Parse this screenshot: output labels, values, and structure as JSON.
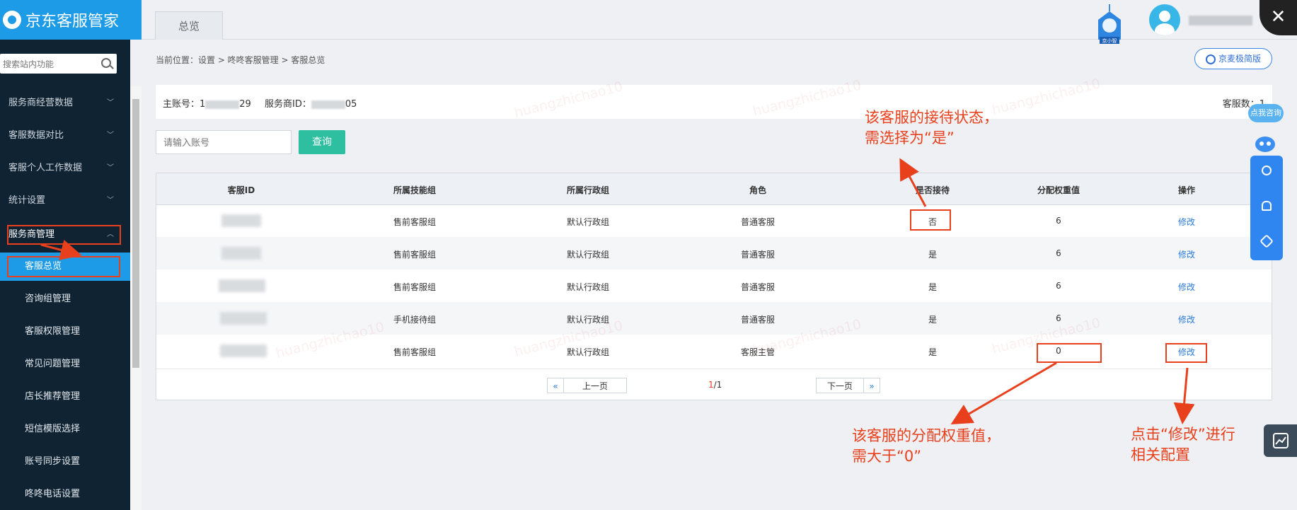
{
  "app": {
    "logo_text": "京东客服管家"
  },
  "sidebar": {
    "search_placeholder": "搜索站内功能",
    "menus": [
      {
        "label": "服务商经营数据"
      },
      {
        "label": "客服数据对比"
      },
      {
        "label": "客服个人工作数据"
      },
      {
        "label": "统计设置"
      },
      {
        "label": "服务商管理"
      }
    ],
    "subitems": [
      {
        "label": "客服总览"
      },
      {
        "label": "咨询组管理"
      },
      {
        "label": "客服权限管理"
      },
      {
        "label": "常见问题管理"
      },
      {
        "label": "店长推荐管理"
      },
      {
        "label": "短信模版选择"
      },
      {
        "label": "账号同步设置"
      },
      {
        "label": "咚咚电话设置"
      }
    ]
  },
  "header": {
    "tab_label": "总览",
    "bot_label": "京小智",
    "close_symbol": "✕"
  },
  "breadcrumb": "当前位置：设置 > 咚咚客服管理 > 客服总览",
  "jd_button_label": "京麦极简版",
  "info": {
    "account_label": "主账号：1",
    "account_tail": "29",
    "service_id_label": "服务商ID：",
    "service_id_tail": "05",
    "service_count_label": "客服数：1"
  },
  "filter": {
    "input_placeholder": "请输入账号",
    "query_label": "查询"
  },
  "table": {
    "columns": [
      "客服ID",
      "所属技能组",
      "所属行政组",
      "角色",
      "是否接待",
      "分配权重值",
      "操作"
    ],
    "rows": [
      {
        "skill_group": "售前客服组",
        "admin_group": "默认行政组",
        "role": "普通客服",
        "reception": "否",
        "weight": "6",
        "action": "修改"
      },
      {
        "skill_group": "售前客服组",
        "admin_group": "默认行政组",
        "role": "普通客服",
        "reception": "是",
        "weight": "6",
        "action": "修改"
      },
      {
        "skill_group": "售前客服组",
        "admin_group": "默认行政组",
        "role": "普通客服",
        "reception": "是",
        "weight": "6",
        "action": "修改"
      },
      {
        "skill_group": "手机接待组",
        "admin_group": "默认行政组",
        "role": "普通客服",
        "reception": "是",
        "weight": "6",
        "action": "修改"
      },
      {
        "skill_group": "售前客服组",
        "admin_group": "默认行政组",
        "role": "客服主管",
        "reception": "是",
        "weight": "0",
        "action": "修改"
      }
    ]
  },
  "pager": {
    "first_symbol": "«",
    "prev_label": "上一页",
    "current": "1",
    "total": "/1",
    "next_label": "下一页",
    "last_symbol": "»"
  },
  "right_toolbar": {
    "consult_label": "点我咨询"
  },
  "annotations": {
    "reception_note_line1": "该客服的接待状态，",
    "reception_note_line2": "需选择为“是”",
    "weight_note_line1": "该客服的分配权重值，",
    "weight_note_line2": "需大于“0”",
    "edit_note_line1": "点击“修改”进行",
    "edit_note_line2": "相关配置"
  },
  "watermarks": {
    "name_a": "huangzhichao10",
    "name_b": "luoshen0229"
  },
  "colors": {
    "brand_blue": "#1e9be6",
    "annotation_red": "#e8401c",
    "query_green": "#2ebfa0",
    "sidebar_dark": "#0f2333"
  }
}
